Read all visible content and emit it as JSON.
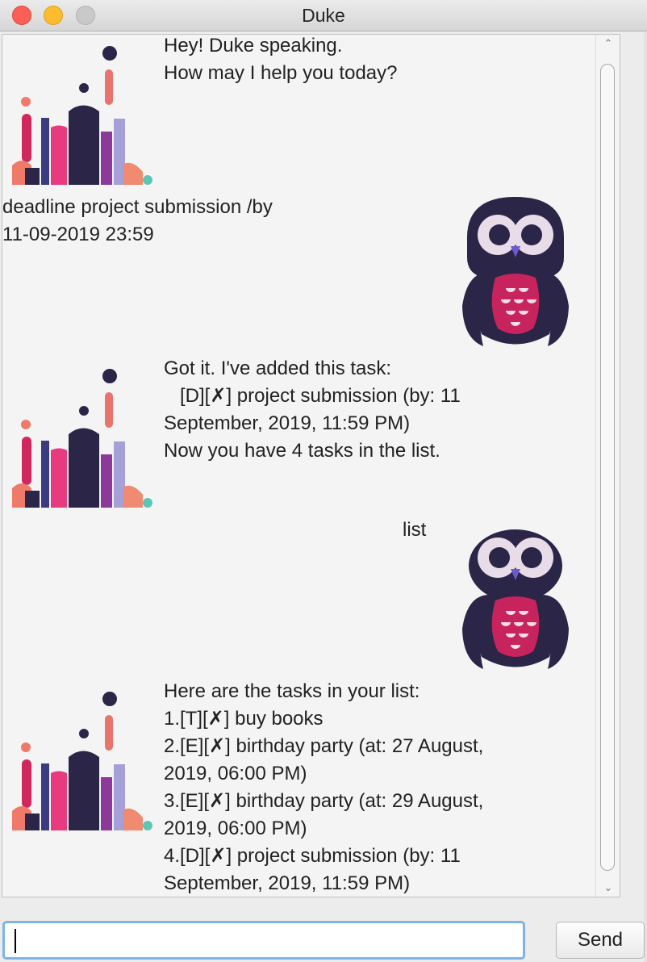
{
  "window": {
    "title": "Duke"
  },
  "messages": [
    {
      "sender": "duke",
      "text": "Hey! Duke speaking.\nHow may I help you today?"
    },
    {
      "sender": "user",
      "text": "deadline project submission /by\n11-09-2019 23:59"
    },
    {
      "sender": "duke",
      "text": "Got it. I've added this task:\n   [D][✗] project submission (by: 11\nSeptember, 2019, 11:59 PM)\nNow you have 4 tasks in the list."
    },
    {
      "sender": "user",
      "text": "list"
    },
    {
      "sender": "duke",
      "text": "Here are the tasks in your list:\n1.[T][✗] buy books\n2.[E][✗] birthday party (at: 27 August,\n2019, 06:00 PM)\n3.[E][✗] birthday party (at: 29 August,\n2019, 06:00 PM)\n4.[D][✗] project submission (by: 11\nSeptember, 2019, 11:59 PM)"
    }
  ],
  "input": {
    "value": "",
    "placeholder": ""
  },
  "send": {
    "label": "Send"
  },
  "icons": {
    "close": "close-dot",
    "minimize": "minimize-dot",
    "maximize": "maximize-dot",
    "duke_avatar": "abstract-bars-avatar",
    "user_avatar": "owl-avatar",
    "scroll_up": "chevron-up-icon",
    "scroll_down": "chevron-down-icon"
  },
  "colors": {
    "close": "#fc5f57",
    "minimize": "#fdbc2e",
    "maximize": "#c9c9c9",
    "input_focus": "#7cb4e8",
    "owl_body": "#2b2548",
    "owl_chest": "#c7235c"
  }
}
